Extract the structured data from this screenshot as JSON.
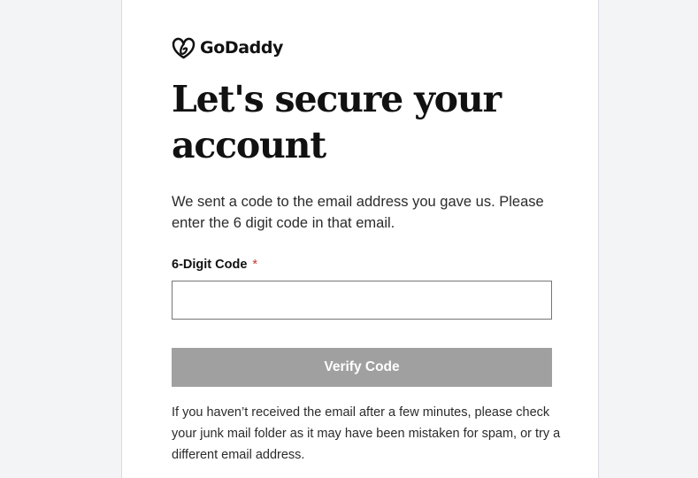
{
  "brand": {
    "name": "GoDaddy",
    "logo_icon": "godaddy-heart-logo-icon"
  },
  "heading": {
    "title": "Let's secure your account"
  },
  "instructions": {
    "text": "We sent a code to the email address you gave us. Please enter the 6 digit code in that email."
  },
  "code_field": {
    "label": "6-Digit Code",
    "required_marker": "*",
    "value": "",
    "placeholder": ""
  },
  "verify_button": {
    "label": "Verify Code",
    "state": "disabled"
  },
  "help": {
    "text": "If you haven’t received the email after a few minutes, please check your junk mail folder as it may have been mistaken for spam, or try a different email address."
  },
  "colors": {
    "button_disabled": "#a0a0a0",
    "text_primary": "#111111",
    "required": "#c0392b",
    "page_background": "#f3f4f6"
  }
}
